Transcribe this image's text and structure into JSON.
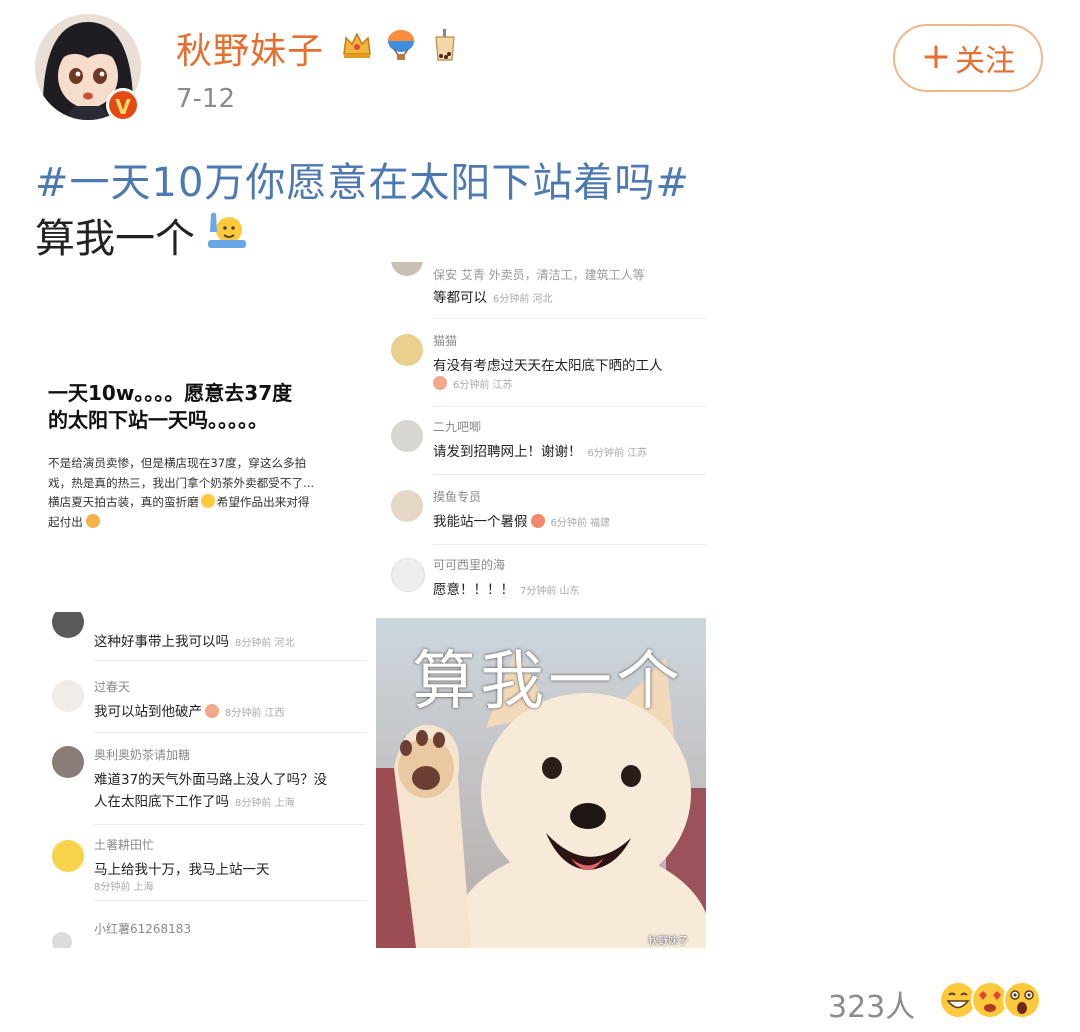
{
  "post": {
    "author": "秋野妹子",
    "verified_badge": "V",
    "date": "7-12",
    "follow_label": "关注",
    "hashtag": "#一天10万你愿意在太阳下站着吗#",
    "text": "算我一个",
    "reaction_count": "323人",
    "badge_icons": [
      "crown-icon",
      "hot-air-balloon-icon",
      "bubble-tea-icon"
    ],
    "reaction_icons": [
      "grin-emoji-icon",
      "heart-eyes-emoji-icon",
      "surprised-emoji-icon"
    ]
  },
  "colors": {
    "username": "#e76f2e",
    "hashtag": "#4d79b2",
    "follow_border": "#f0b889",
    "meta": "#8c8c8c"
  },
  "collage": {
    "article": {
      "title_line1": "一天10w。。。。愿意去37度",
      "title_line2": "的太阳下站一天吗。。。。。",
      "body_lines": [
        "不是给演员卖惨，但是横店现在37度，穿这么多拍",
        "戏，热是真的热三，我出门拿个奶茶外卖都受不了...",
        "横店夏天拍古装，真的蛮折磨",
        "希望作品出来对得",
        "起付出"
      ]
    },
    "right_comments": [
      {
        "text": "等都可以",
        "meta": "6分钟前  河北"
      },
      {
        "name": "猫猫",
        "text": "有没有考虑过天天在太阳底下晒的工人",
        "meta": "6分钟前  江苏"
      },
      {
        "name": "二九吧唧",
        "text": "请发到招聘网上！谢谢！",
        "meta": "6分钟前  江苏"
      },
      {
        "name": "摸鱼专员",
        "text": "我能站一个暑假",
        "meta": "6分钟前  福建"
      },
      {
        "name": "可可西里的海",
        "text": "愿意！！！！",
        "meta": "7分钟前  山东"
      }
    ],
    "left_comments": [
      {
        "text": "这种好事带上我可以吗",
        "meta": "8分钟前  河北"
      },
      {
        "name": "过春天",
        "text": "我可以站到他破产",
        "meta": "8分钟前  江西"
      },
      {
        "name": "奥利奥奶茶请加糖",
        "text": "难道37的天气外面马路上没人了吗？没",
        "text2": "人在太阳底下工作了吗",
        "meta": "8分钟前  上海"
      },
      {
        "name": "土著耕田忙",
        "text": "马上给我十万，我马上站一天",
        "meta": "8分钟前  上海"
      },
      {
        "name": "小红薯61268183"
      }
    ],
    "meme": {
      "caption": "算我一个",
      "watermark": "秋野妹子"
    }
  }
}
